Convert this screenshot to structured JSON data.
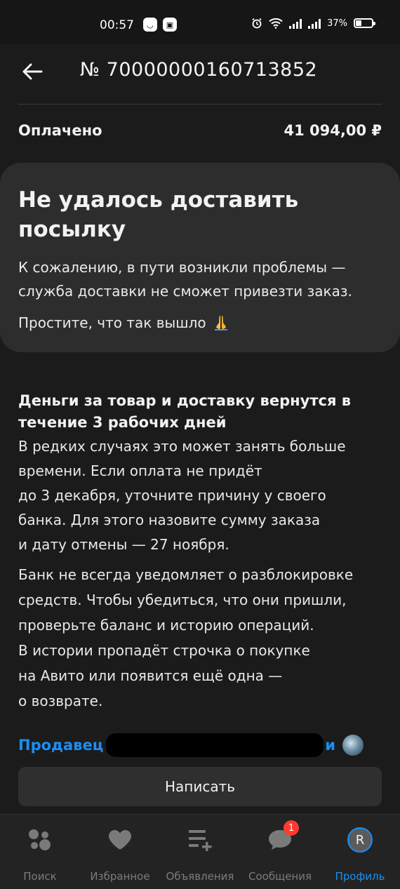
{
  "status_bar": {
    "time": "00:57",
    "battery_text": "37%",
    "battery_level": 0.37
  },
  "header": {
    "title": "№ 70000000160713852"
  },
  "payment": {
    "label": "Оплачено",
    "amount": "41 094,00 ₽"
  },
  "notice": {
    "title": "Не удалось доставить посылку",
    "lines": [
      "К сожалению, в пути возникли проблемы —",
      "служба доставки не сможет привезти заказ."
    ],
    "sorry": "Простите, что так вышло"
  },
  "refund": {
    "title": "Деньги за товар и доставку вернутся в течение 3 рабочих дней",
    "lines": [
      "В редких случаях это может занять больше",
      "времени. Если оплата не придёт",
      "до 3 декабря, уточните причину у своего",
      "банка. Для этого назовите сумму заказа",
      "и дату отмены — 27 ноября."
    ],
    "bank_lines": [
      "Банк не всегда уведомляет о разблокировке",
      "средств. Чтобы убедиться, что они пришли,",
      "проверьте баланс и историю операций.",
      "В истории пропадёт строчка о покупке",
      "на Авито или появится ещё одна —",
      "о возврате."
    ]
  },
  "seller": {
    "label": "Продавец",
    "name_suffix": "и"
  },
  "actions": {
    "write_label": "Написать"
  },
  "bottom_nav": {
    "items": [
      {
        "label": "Поиск",
        "icon": "search-dots-icon"
      },
      {
        "label": "Избранное",
        "icon": "heart-icon"
      },
      {
        "label": "Объявления",
        "icon": "listings-add-icon"
      },
      {
        "label": "Сообщения",
        "icon": "chat-bubble-icon",
        "badge": "1"
      },
      {
        "label": "Профиль",
        "icon": "avatar",
        "avatar_letter": "R",
        "active": true
      }
    ]
  },
  "colors": {
    "background": "#1b1b1b",
    "card": "#2d2d2d",
    "accent": "#1a8ef5",
    "badge": "#ff3b30"
  }
}
